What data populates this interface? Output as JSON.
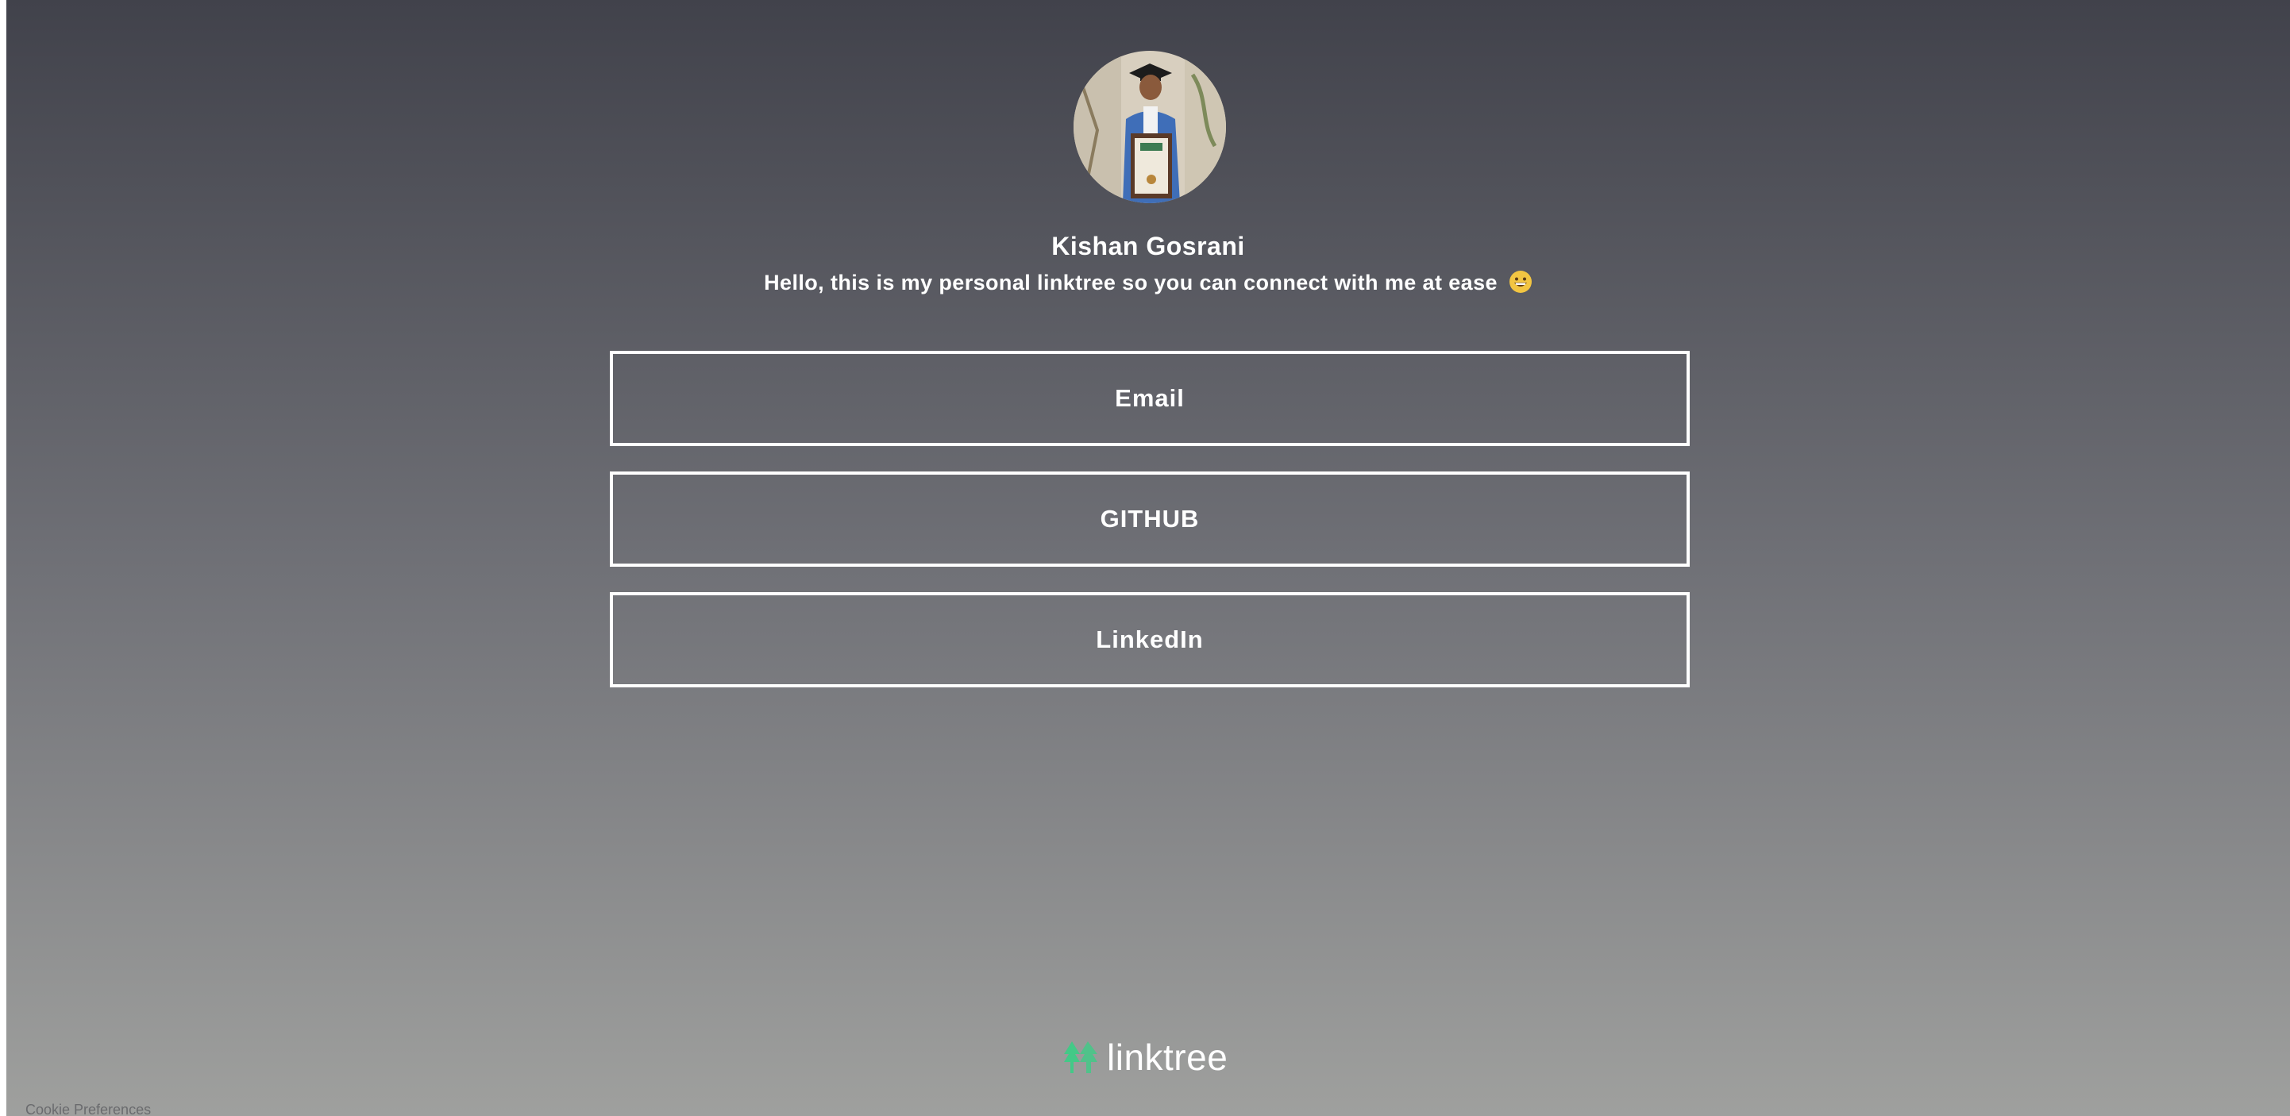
{
  "profile": {
    "name": "Kishan Gosrani",
    "bio": "Hello, this is my personal linktree so you can connect with me at ease",
    "bio_emoji_icon": "grinning-face-emoji"
  },
  "links": [
    {
      "label": "Email"
    },
    {
      "label": "GITHUB"
    },
    {
      "label": "LinkedIn"
    }
  ],
  "footer": {
    "logo_icon": "linktree-logo-icon",
    "logo_text": "linktree",
    "cookie_label": "Cookie Preferences"
  },
  "colors": {
    "background_top": "#41424b",
    "background_bottom": "#9fa09e",
    "text": "#ffffff",
    "button_border": "#ffffff",
    "logo_accent": "#43c987"
  }
}
